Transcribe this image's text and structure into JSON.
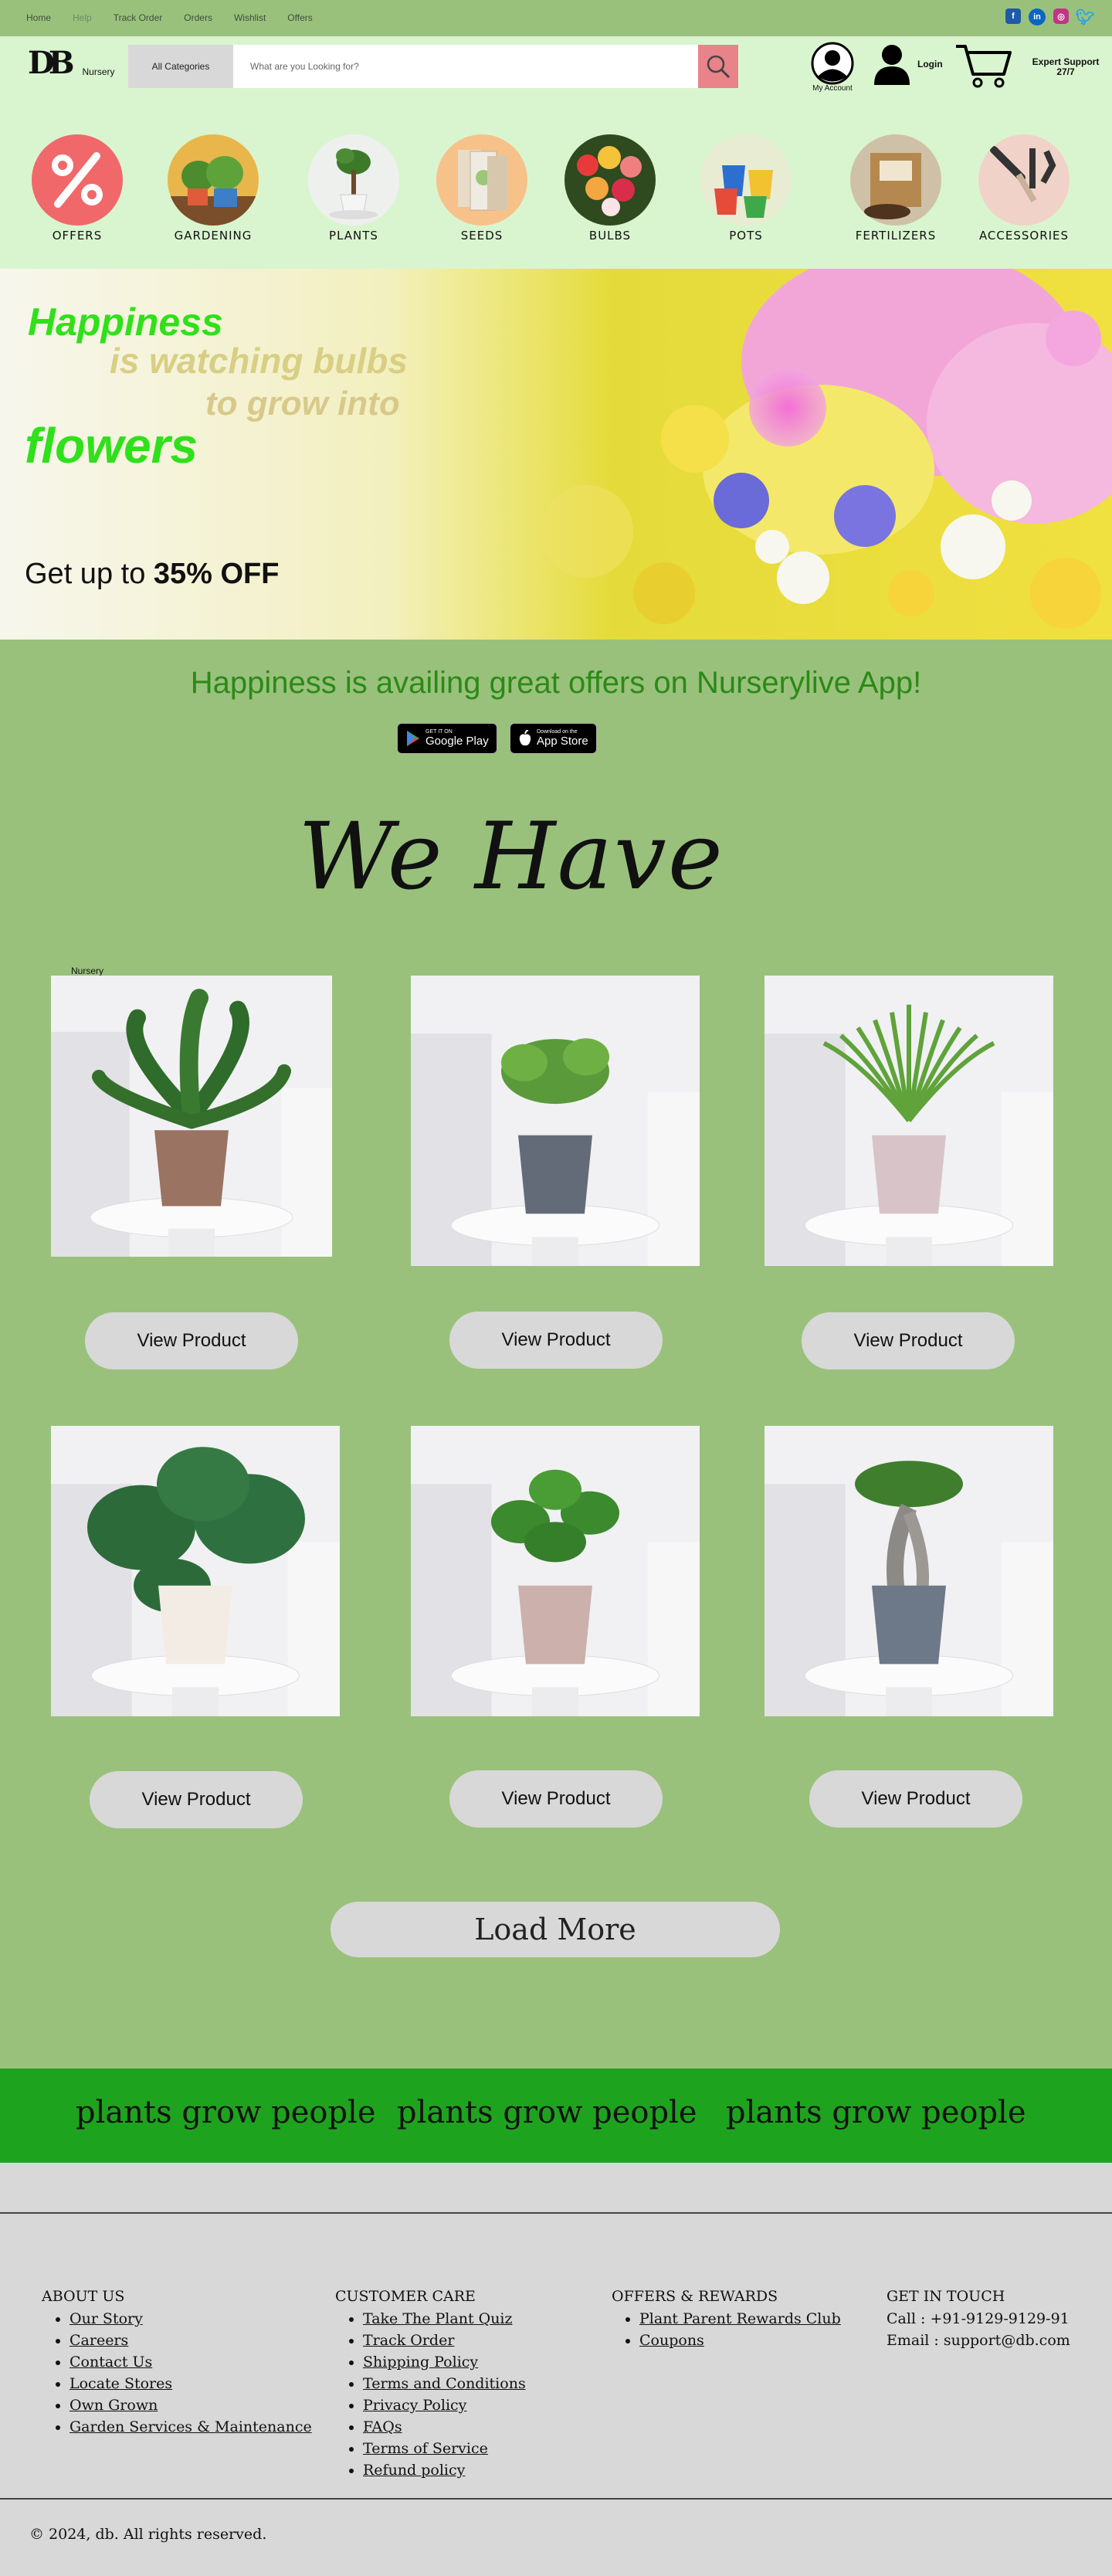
{
  "topnav": [
    "Home",
    "Help",
    "Track Order",
    "Orders",
    "Wishlist",
    "Offers"
  ],
  "social": [
    {
      "icon": "facebook-icon",
      "color": "#1f5aa6"
    },
    {
      "icon": "linkedin-icon",
      "color": "#0a66c2"
    },
    {
      "icon": "instagram-icon",
      "color": "#c13584"
    },
    {
      "icon": "twitter-icon",
      "color": "#1da1f2"
    }
  ],
  "header": {
    "logo_mark": "DB",
    "logo_text": "Nursery",
    "category_label": "All Categories",
    "search_placeholder": "What are you Looking for?",
    "account_label": "My Account",
    "login_label": "Login",
    "expert_label": "Expert Support 27/7"
  },
  "categories": [
    {
      "label": "OFFERS"
    },
    {
      "label": "GARDENING"
    },
    {
      "label": "PLANTS"
    },
    {
      "label": "SEEDS"
    },
    {
      "label": "BULBS"
    },
    {
      "label": "POTS"
    },
    {
      "label": "FERTILIZERS"
    },
    {
      "label": "ACCESSORIES"
    }
  ],
  "banner": {
    "line1": "Happiness",
    "line2": "is watching bulbs",
    "line3": "to grow into",
    "line4": "flowers",
    "offer_prefix": "Get up to ",
    "offer_value": "35% OFF"
  },
  "app": {
    "text": "Happiness is availing great offers on Nurserylive App!",
    "google_small": "GET IT ON",
    "google_big": "Google Play",
    "apple_small": "Download on the",
    "apple_big": "App Store"
  },
  "section_title": "We Have",
  "nursery_tag": "Nursery",
  "products": [
    {
      "button": "View Product",
      "pot": "#9b7363"
    },
    {
      "button": "View Product",
      "pot": "#646b78"
    },
    {
      "button": "View Product",
      "pot": "#d8c4c8"
    },
    {
      "button": "View Product",
      "pot": "#f2ece4"
    },
    {
      "button": "View Product",
      "pot": "#cbb0ac"
    },
    {
      "button": "View Product",
      "pot": "#6d7889"
    }
  ],
  "load_more": "Load More",
  "marquee": [
    "plants grow people",
    "plants grow people",
    "plants grow people"
  ],
  "footer": {
    "about": {
      "title": "ABOUT US",
      "items": [
        "Our Story",
        "Careers",
        "Contact Us",
        "Locate Stores",
        "Own Grown",
        "Garden Services & Maintenance"
      ]
    },
    "care": {
      "title": "CUSTOMER CARE",
      "items": [
        "Take The Plant Quiz",
        "Track Order",
        "Shipping Policy",
        "Terms and Conditions",
        "Privacy Policy",
        "FAQs",
        "Terms of Service",
        "Refund policy"
      ]
    },
    "offers": {
      "title": "OFFERS & REWARDS",
      "items": [
        "Plant Parent Rewards Club",
        " Coupons"
      ]
    },
    "contact": {
      "title": "GET IN TOUCH",
      "call": "Call : +91-9129-9129-91",
      "email": "Email : support@db.com"
    },
    "copyright": "© 2024, db. All rights reserved."
  }
}
